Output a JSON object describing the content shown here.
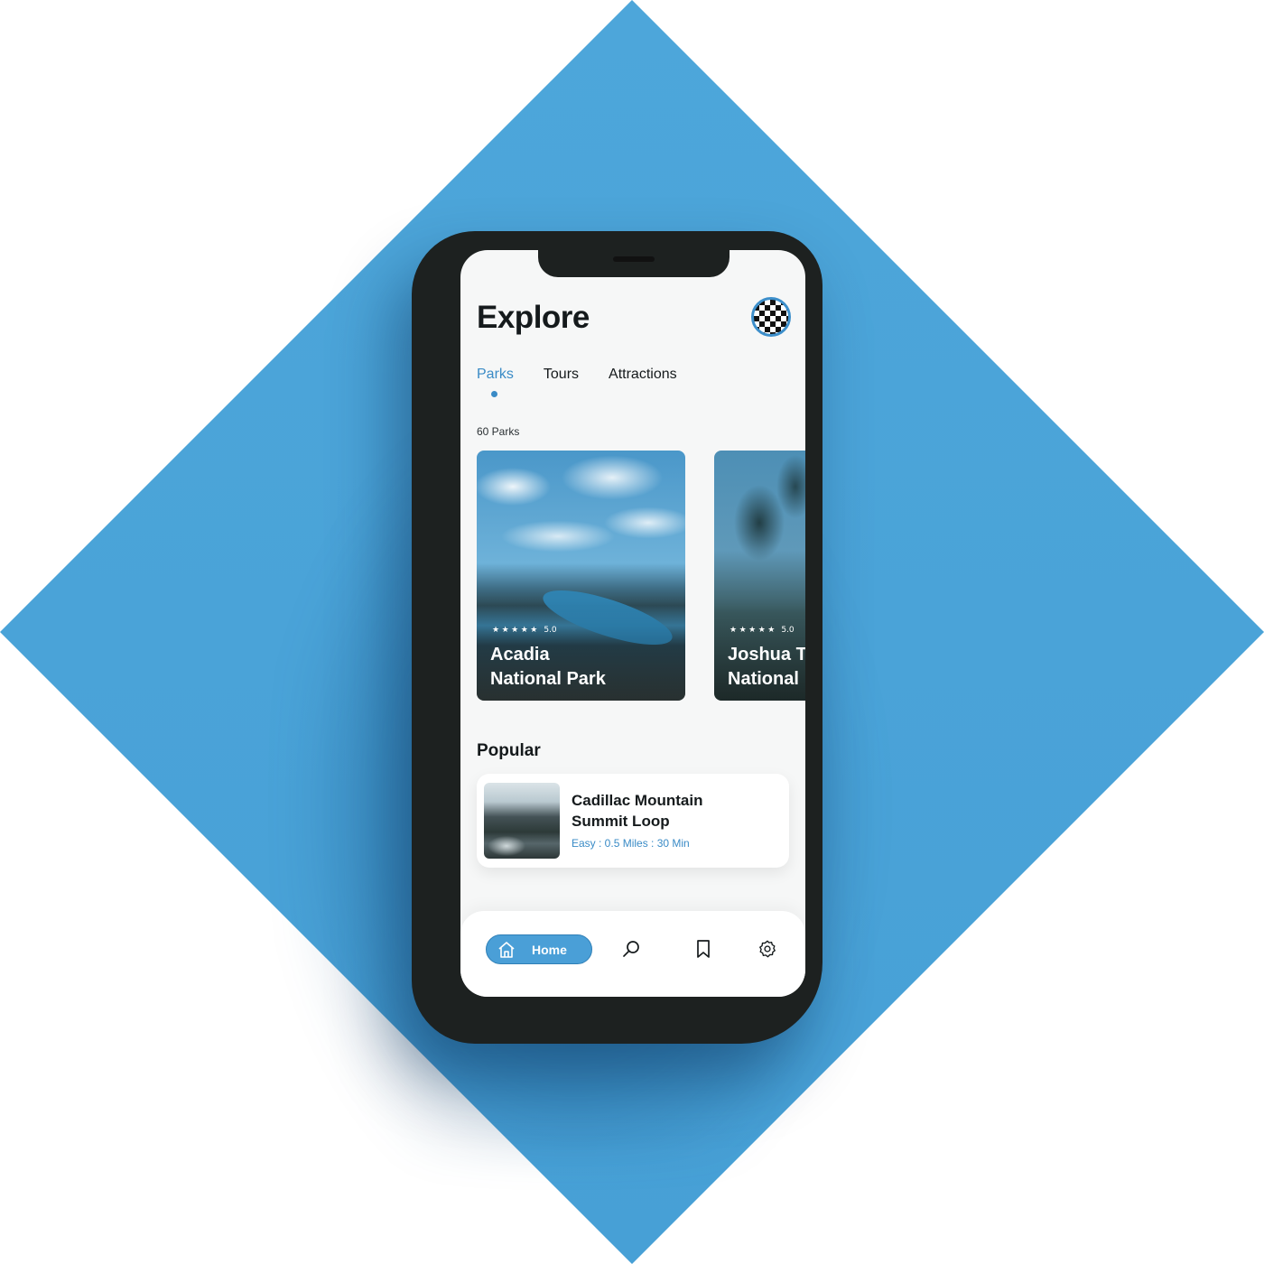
{
  "screen": {
    "title": "Explore",
    "avatar_icon": "checkered-avatar-icon"
  },
  "tabs": [
    {
      "label": "Parks",
      "active": true
    },
    {
      "label": "Tours",
      "active": false
    },
    {
      "label": "Attractions",
      "active": false
    }
  ],
  "parks_count": "60 Parks",
  "park_cards": [
    {
      "name_line1": "Acadia",
      "name_line2": "National Park",
      "stars": "★ ★ ★ ★ ★",
      "rating": "5.0"
    },
    {
      "name_line1": "Joshua T",
      "name_line2": "National",
      "stars": "★ ★ ★ ★ ★",
      "rating": "5.0"
    }
  ],
  "popular": {
    "section_title": "Popular",
    "items": [
      {
        "title_line1": "Cadillac Mountain",
        "title_line2": "Summit Loop",
        "meta": "Easy : 0.5 Miles : 30 Min"
      }
    ]
  },
  "bottom_nav": {
    "home_label": "Home",
    "icons": [
      "home-icon",
      "search-icon",
      "bookmark-icon",
      "settings-gear-icon"
    ]
  },
  "colors": {
    "accent": "#3a8bc6",
    "background_diamond": "#4da6da",
    "phone_body": "#1d2120"
  }
}
